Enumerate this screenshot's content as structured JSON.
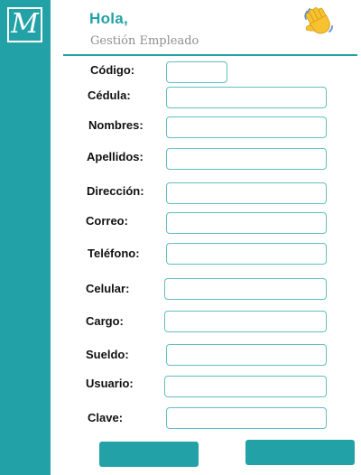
{
  "header": {
    "greeting": "Hola,",
    "subtitle": "Gestión Empleado",
    "logo_letter": "M"
  },
  "colors": {
    "accent": "#22a2a7",
    "field_border": "#5fc0c3",
    "subtitle_text": "#8f8f8f"
  },
  "form": {
    "fields": [
      {
        "label": "Código:",
        "value": ""
      },
      {
        "label": "Cédula:",
        "value": ""
      },
      {
        "label": "Nombres:",
        "value": ""
      },
      {
        "label": "Apellidos:",
        "value": ""
      },
      {
        "label": "Dirección:",
        "value": ""
      },
      {
        "label": "Correo:",
        "value": ""
      },
      {
        "label": "Teléfono:",
        "value": ""
      },
      {
        "label": "Celular:",
        "value": ""
      },
      {
        "label": "Cargo:",
        "value": ""
      },
      {
        "label": "Sueldo:",
        "value": ""
      },
      {
        "label": "Usuario:",
        "value": ""
      },
      {
        "label": "Clave:",
        "value": ""
      }
    ]
  },
  "buttons": {
    "left_label": "",
    "right_label": ""
  },
  "icons": {
    "logo": "monogram-logo",
    "greeting": "waving-hand-icon"
  }
}
